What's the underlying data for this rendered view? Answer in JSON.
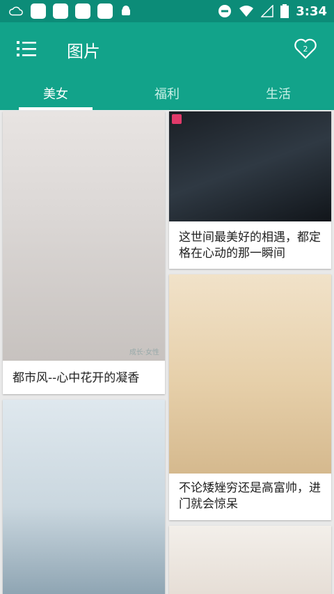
{
  "status_bar": {
    "time": "3:34",
    "icons": [
      "cloud-icon",
      "app-icon",
      "app-icon",
      "map-icon",
      "s-app-icon",
      "android-icon",
      "do-not-disturb-icon",
      "wifi-icon",
      "signal-icon",
      "battery-icon"
    ]
  },
  "app_bar": {
    "title": "图片",
    "menu_icon": "menu-icon",
    "favorites_icon": "heart-icon",
    "favorites_count": "2"
  },
  "tabs": [
    {
      "label": "美女",
      "active": true
    },
    {
      "label": "福利",
      "active": false
    },
    {
      "label": "生活",
      "active": false
    }
  ],
  "cards": [
    {
      "caption": "都市风--心中花开的凝香",
      "watermark": "成长·女性"
    },
    {
      "caption": "这世间最美好的相遇，都定格在心动的那一瞬间"
    },
    {
      "caption": "不论矮矬穷还是高富帅，进门就会惊呆"
    },
    {
      "caption": ""
    },
    {
      "caption": ""
    }
  ],
  "colors": {
    "status_bar": "#0c8c78",
    "app_bar": "#12a38a",
    "background": "#e9e9e9"
  }
}
